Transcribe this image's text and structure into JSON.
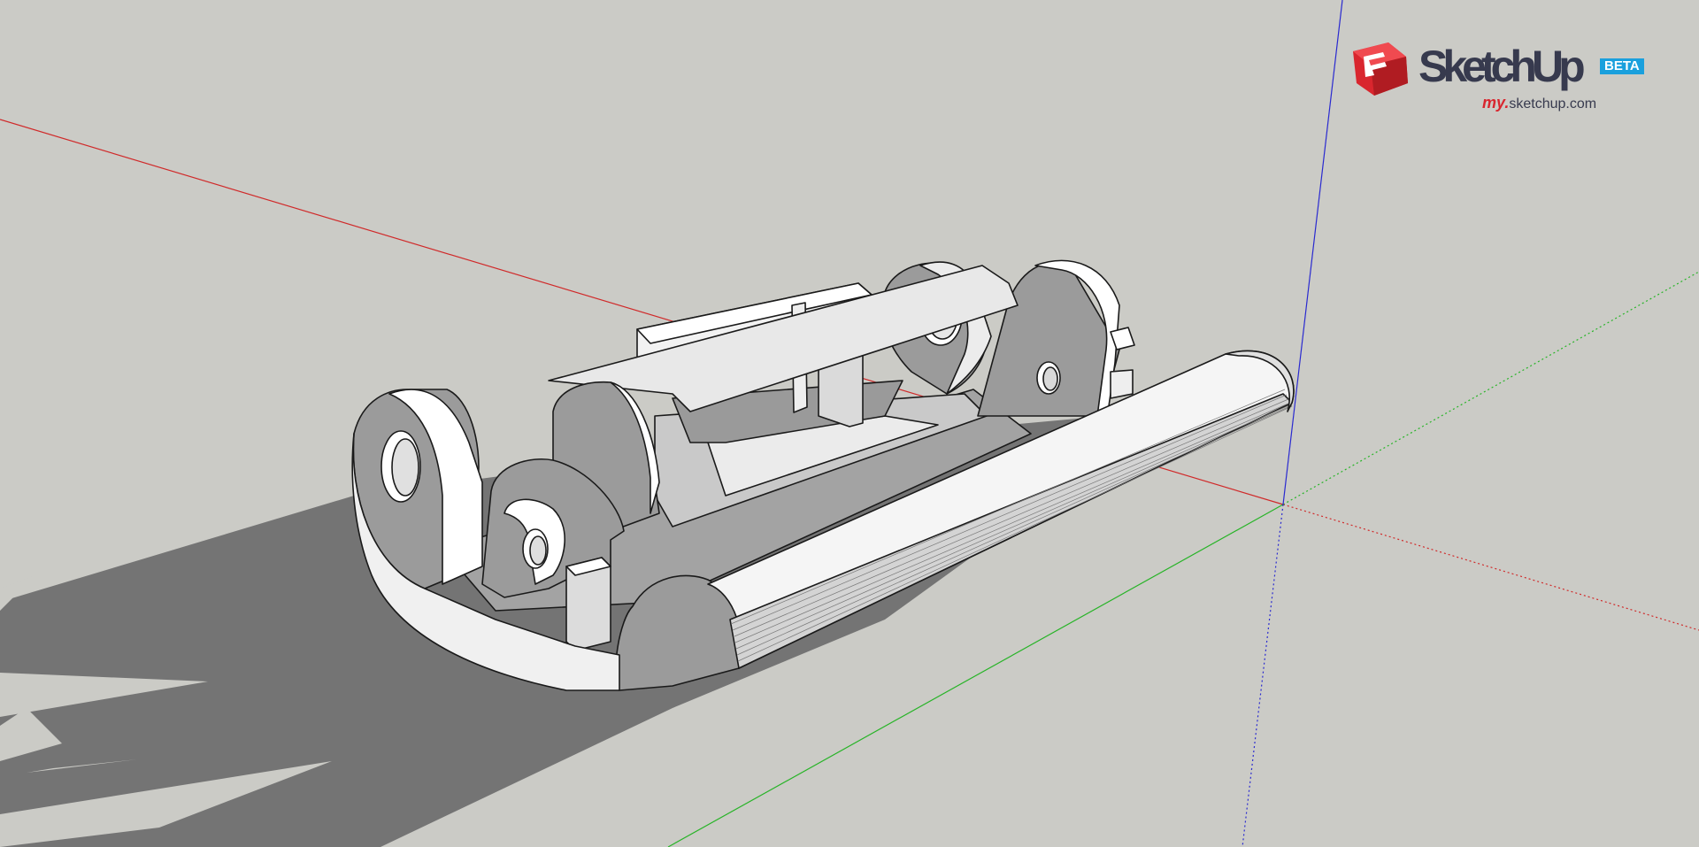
{
  "app": {
    "name": "SketchUp"
  },
  "watermark": {
    "product": "SketchUp",
    "badge": "BETA",
    "url_prefix": "my.",
    "url_domain": "sketchup.com"
  },
  "scene": {
    "axes": {
      "red_color": "#d02a2a",
      "green_color": "#28b428",
      "blue_color": "#2a2ad0"
    },
    "background_color": "#cbcbc6",
    "shadow_color": "#737373",
    "model_face_colors": [
      "#ffffff",
      "#e6e6e6",
      "#bdbdbd",
      "#9b9b9b"
    ],
    "brand_red": "#d9262e",
    "brand_blue": "#1aa0dd"
  }
}
